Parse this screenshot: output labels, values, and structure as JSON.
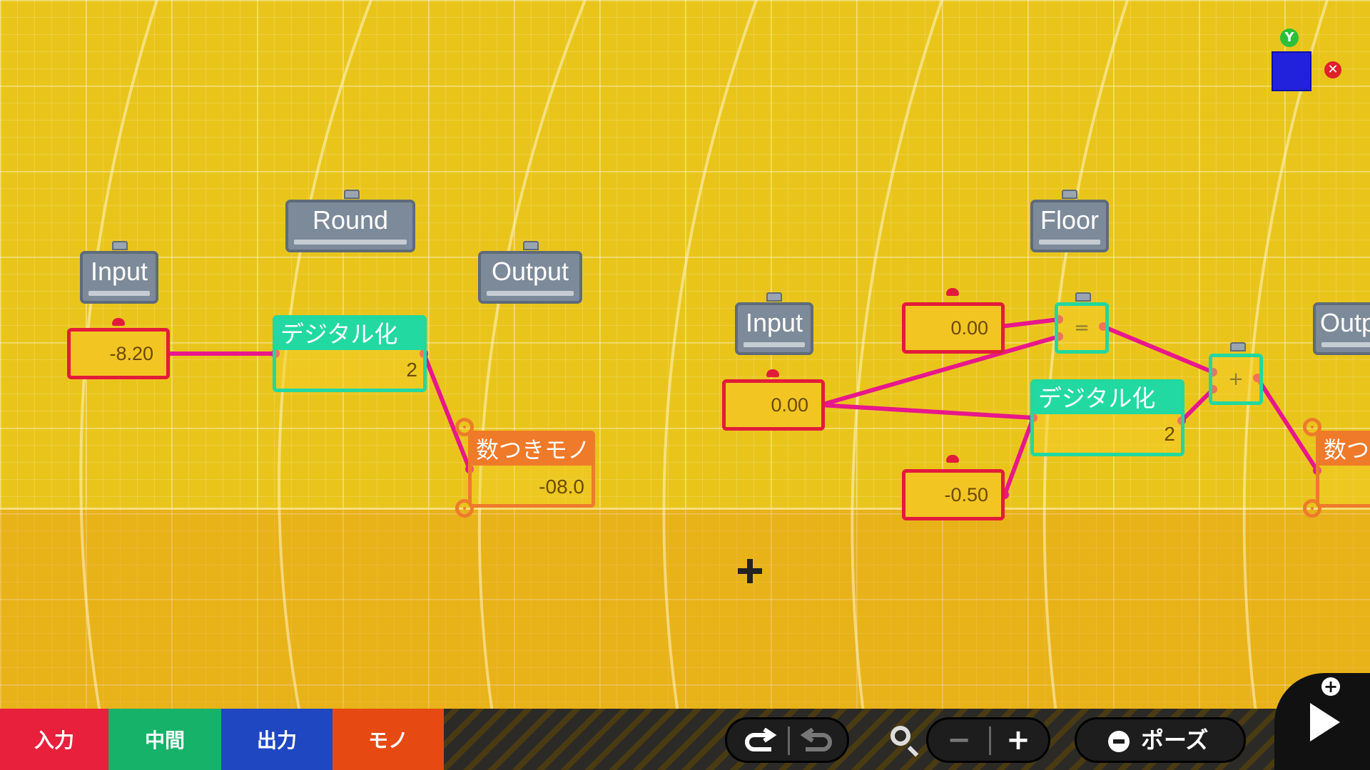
{
  "nodes": {
    "left": {
      "input_label": "Input",
      "round_label": "Round",
      "output_label": "Output",
      "input_value": "-8.20",
      "digitize_label": "デジタル化",
      "digitize_value": "2",
      "numobj_label": "数つきモノ",
      "numobj_value": "-08.0"
    },
    "right": {
      "input_label": "Input",
      "floor_label": "Floor",
      "output_label_partial": "Outp",
      "input_value": "0.00",
      "const_top_value": "0.00",
      "const_bottom_value": "-0.50",
      "equals_symbol": "=",
      "plus_symbol": "+",
      "digitize_label": "デジタル化",
      "digitize_value": "2",
      "numobj_label_partial": "数つ"
    }
  },
  "axis_widget": {
    "y_label": "Y",
    "x_symbol": "✕"
  },
  "toolbar": {
    "tabs": [
      {
        "label": "入力",
        "color": "#e8203c"
      },
      {
        "label": "中間",
        "color": "#17b26a"
      },
      {
        "label": "出力",
        "color": "#1f47c2"
      },
      {
        "label": "モノ",
        "color": "#e64a12"
      }
    ],
    "undo_icon": "undo-arrow-icon",
    "redo_icon": "redo-arrow-icon",
    "zoom_icon": "search-icon",
    "zoom_out": "−",
    "zoom_in": "+",
    "pause_label": "ポーズ",
    "pause_icon": "minus-circle-icon",
    "play_icon": "play-icon",
    "play_plus": "+"
  }
}
